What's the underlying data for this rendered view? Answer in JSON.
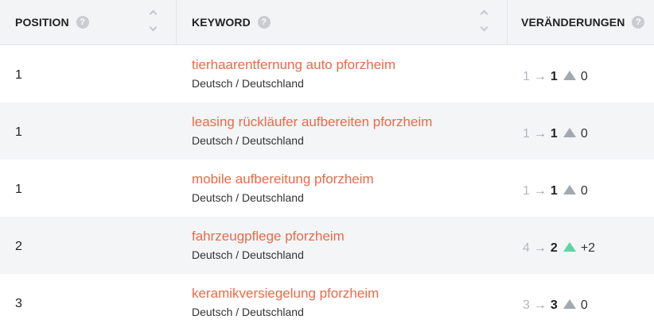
{
  "header": {
    "position": "POSITION",
    "keyword": "KEYWORD",
    "changes": "VERÄNDERUNGEN",
    "help": "?"
  },
  "colors": {
    "keyword": "#ea6a47",
    "neutral_triangle": "#a3a9ae",
    "up_triangle": "#5fd4a6"
  },
  "rows": [
    {
      "position": "1",
      "keyword": "tierhaarentfernung auto pforzheim",
      "locale": "Deutsch / Deutschland",
      "prev": "1",
      "arrow": "→",
      "current": "1",
      "trend": "neutral",
      "delta": "0"
    },
    {
      "position": "1",
      "keyword": "leasing rückläufer aufbereiten pforzheim",
      "locale": "Deutsch / Deutschland",
      "prev": "1",
      "arrow": "→",
      "current": "1",
      "trend": "neutral",
      "delta": "0"
    },
    {
      "position": "1",
      "keyword": "mobile aufbereitung pforzheim",
      "locale": "Deutsch / Deutschland",
      "prev": "1",
      "arrow": "→",
      "current": "1",
      "trend": "neutral",
      "delta": "0"
    },
    {
      "position": "2",
      "keyword": "fahrzeugpflege pforzheim",
      "locale": "Deutsch / Deutschland",
      "prev": "4",
      "arrow": "→",
      "current": "2",
      "trend": "up",
      "delta": "+2"
    },
    {
      "position": "3",
      "keyword": "keramikversiegelung pforzheim",
      "locale": "Deutsch / Deutschland",
      "prev": "3",
      "arrow": "→",
      "current": "3",
      "trend": "neutral",
      "delta": "0"
    }
  ]
}
